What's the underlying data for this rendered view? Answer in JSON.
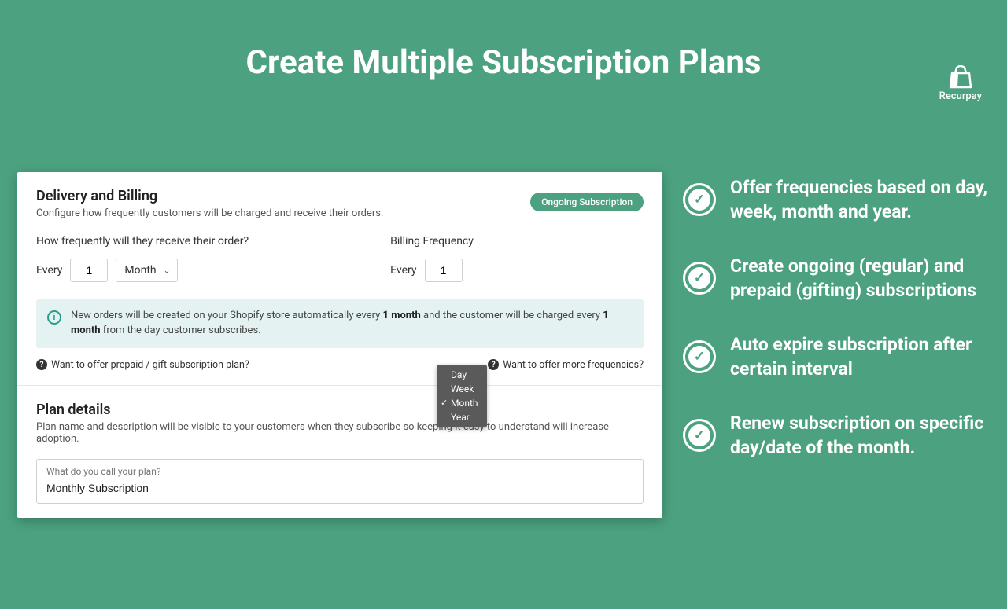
{
  "brand": {
    "name": "Recurpay"
  },
  "hero": {
    "title": "Create Multiple Subscription Plans"
  },
  "panel": {
    "delivery": {
      "title": "Delivery and Billing",
      "desc": "Configure how frequently customers will be charged and receive their orders.",
      "pill": "Ongoing Subscription",
      "order_label": "How frequently will they receive their order?",
      "billing_label": "Billing Frequency",
      "every": "Every",
      "order_value": "1",
      "order_unit": "Month",
      "billing_value": "1",
      "dropdown": {
        "day": "Day",
        "week": "Week",
        "month": "Month",
        "year": "Year"
      },
      "info_pre": "New orders will be created on your Shopify store automatically every ",
      "info_bold1": "1 month",
      "info_mid": " and the customer will be charged every ",
      "info_bold2": "1 month",
      "info_post": " from the day customer subscribes.",
      "help_prepaid": "Want to offer prepaid / gift subscription plan?",
      "help_more": "Want to offer more frequencies?"
    },
    "plan": {
      "title": "Plan details",
      "desc": "Plan name and description will be visible to your customers when they subscribe so keeping it easy to understand will increase adoption.",
      "input_label": "What do you call your plan?",
      "input_value": "Monthly Subscription"
    }
  },
  "features": {
    "f1": "Offer frequencies based on day, week, month and year.",
    "f2": "Create ongoing (regular) and prepaid (gifting) subscriptions",
    "f3": "Auto expire subscription after certain interval",
    "f4": "Renew subscription on specific day/date of the month."
  }
}
